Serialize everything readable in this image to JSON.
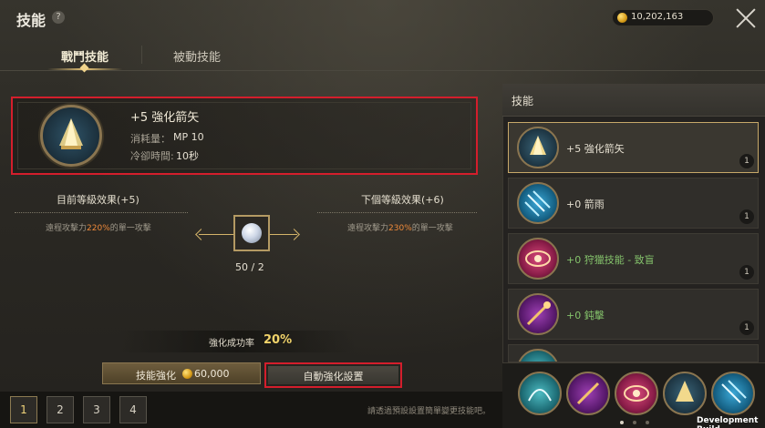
{
  "header": {
    "title": "技能",
    "help_icon": "?",
    "gold": "10,202,163"
  },
  "tabs": [
    {
      "label": "戰鬥技能",
      "active": true
    },
    {
      "label": "被動技能",
      "active": false
    }
  ],
  "skill": {
    "name": "+5 強化箭矢",
    "cost_label": "消耗量：",
    "cost_value": "MP 10",
    "cooldown_label": "冷卻時間:",
    "cooldown_value": "10秒"
  },
  "effects": {
    "current_title": "目前等級效果(+5)",
    "current_desc_pre": "遠程攻擊力",
    "current_desc_pct": "220%",
    "current_desc_post": "的單一攻擊",
    "next_title": "下個等級效果(+6)",
    "next_desc_pre": "遠程攻擊力",
    "next_desc_pct": "230%",
    "next_desc_post": "的單一攻擊"
  },
  "material": {
    "count": "50 / 2"
  },
  "enhance": {
    "rate_label": "強化成功率",
    "rate_value": "20%",
    "button_label": "技能強化",
    "button_cost": "60,000",
    "auto_label": "自動強化設置"
  },
  "presets": {
    "items": [
      "1",
      "2",
      "3",
      "4"
    ],
    "active": "1",
    "hint": "請透過預設設置簡單變更技能吧。"
  },
  "panel": {
    "title": "技能",
    "skills": [
      {
        "name": "+5 強化箭矢",
        "badge": "1",
        "icon": "arrow-icon",
        "selected": true,
        "green": false
      },
      {
        "name": "+0 箭雨",
        "badge": "1",
        "icon": "arrow-rain-icon",
        "selected": false,
        "green": false
      },
      {
        "name": "+0 狩獵技能 - 致盲",
        "badge": "1",
        "icon": "eye-icon",
        "selected": false,
        "green": true
      },
      {
        "name": "+0 鈍擊",
        "badge": "1",
        "icon": "blunt-strike-icon",
        "selected": false,
        "green": true
      }
    ]
  },
  "quickbar": {
    "icons": [
      "arc-icon",
      "blunt-strike-icon",
      "eye-icon",
      "arrow-icon",
      "arrow-rain-icon"
    ]
  },
  "footer": {
    "build_label": "Development Build"
  },
  "colors": {
    "accent_gold": "#e8c577",
    "highlight_red": "#d41e2c",
    "percent_orange": "#f08a3a",
    "green_text": "#84c26b"
  }
}
